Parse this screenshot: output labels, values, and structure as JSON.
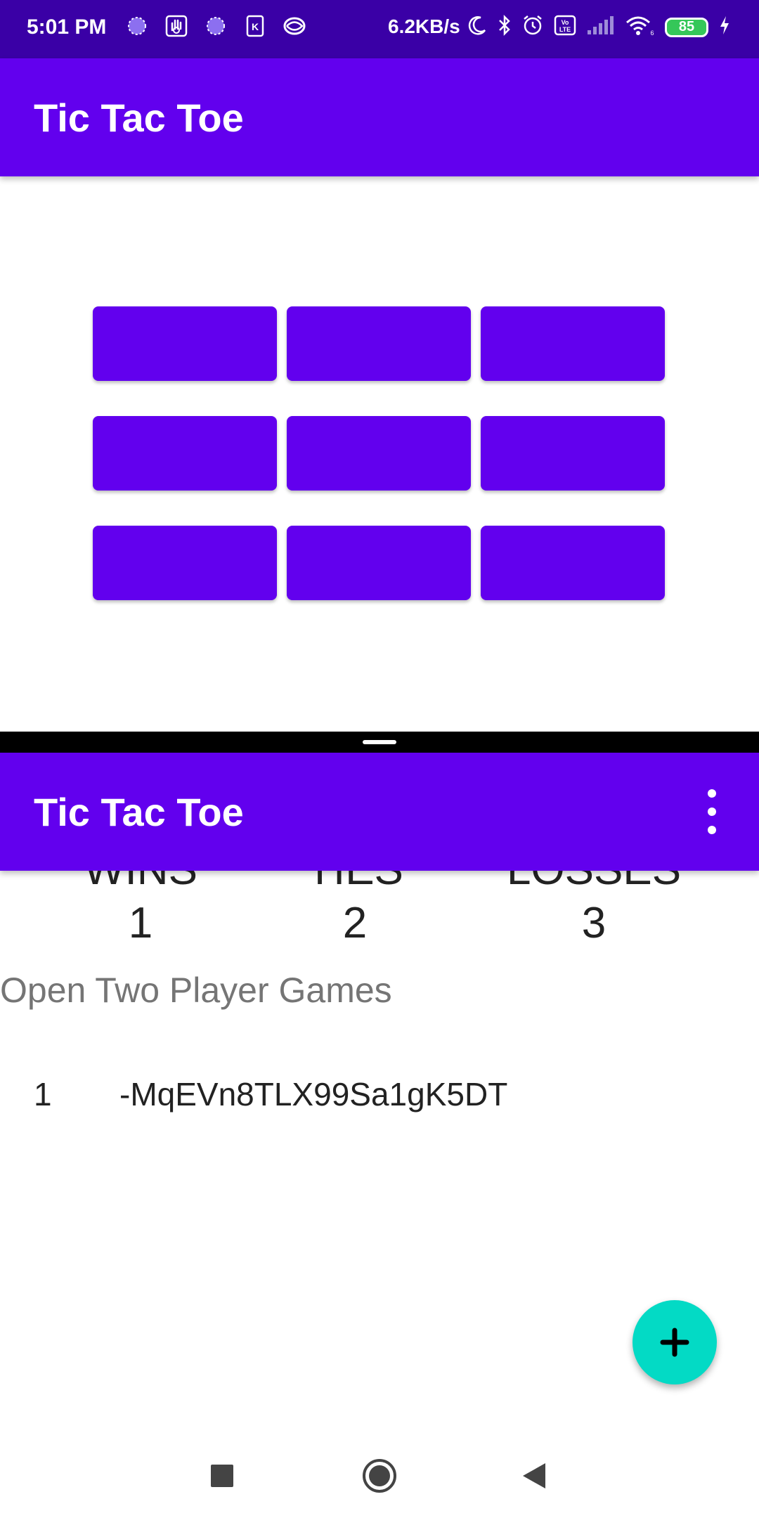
{
  "status_bar": {
    "time": "5:01 PM",
    "net_speed": "6.2KB/s",
    "battery": "85",
    "left_icons": [
      "spinner-icon",
      "hand-icon",
      "spinner-icon",
      "k-app-icon",
      "globe-icon"
    ],
    "right_icons": [
      "moon-icon",
      "bluetooth-icon",
      "alarm-icon",
      "volte-icon",
      "signal-icon",
      "wifi-icon",
      "battery-icon",
      "charging-icon"
    ]
  },
  "top_app": {
    "title": "Tic Tac Toe",
    "board_cells": [
      "",
      "",
      "",
      "",
      "",
      "",
      "",
      "",
      ""
    ]
  },
  "bottom_app": {
    "title": "Tic Tac Toe",
    "menu_icon": "more-vert-icon",
    "stats": {
      "wins_label": "WINS",
      "wins_value": "1",
      "ties_label": "TIES",
      "ties_value": "2",
      "losses_label": "LOSSES",
      "losses_value": "3"
    },
    "open_games_title": "Open Two Player Games",
    "games": [
      {
        "num": "1",
        "id": "-MqEVn8TLX99Sa1gK5DT"
      }
    ],
    "fab_icon": "plus-icon"
  },
  "nav_bar": {
    "icons": [
      "recents-icon",
      "home-icon",
      "back-icon"
    ]
  },
  "colors": {
    "primary": "#6200ee",
    "status_bar": "#3a00a6",
    "fab": "#03dac5",
    "divider": "#000000"
  }
}
